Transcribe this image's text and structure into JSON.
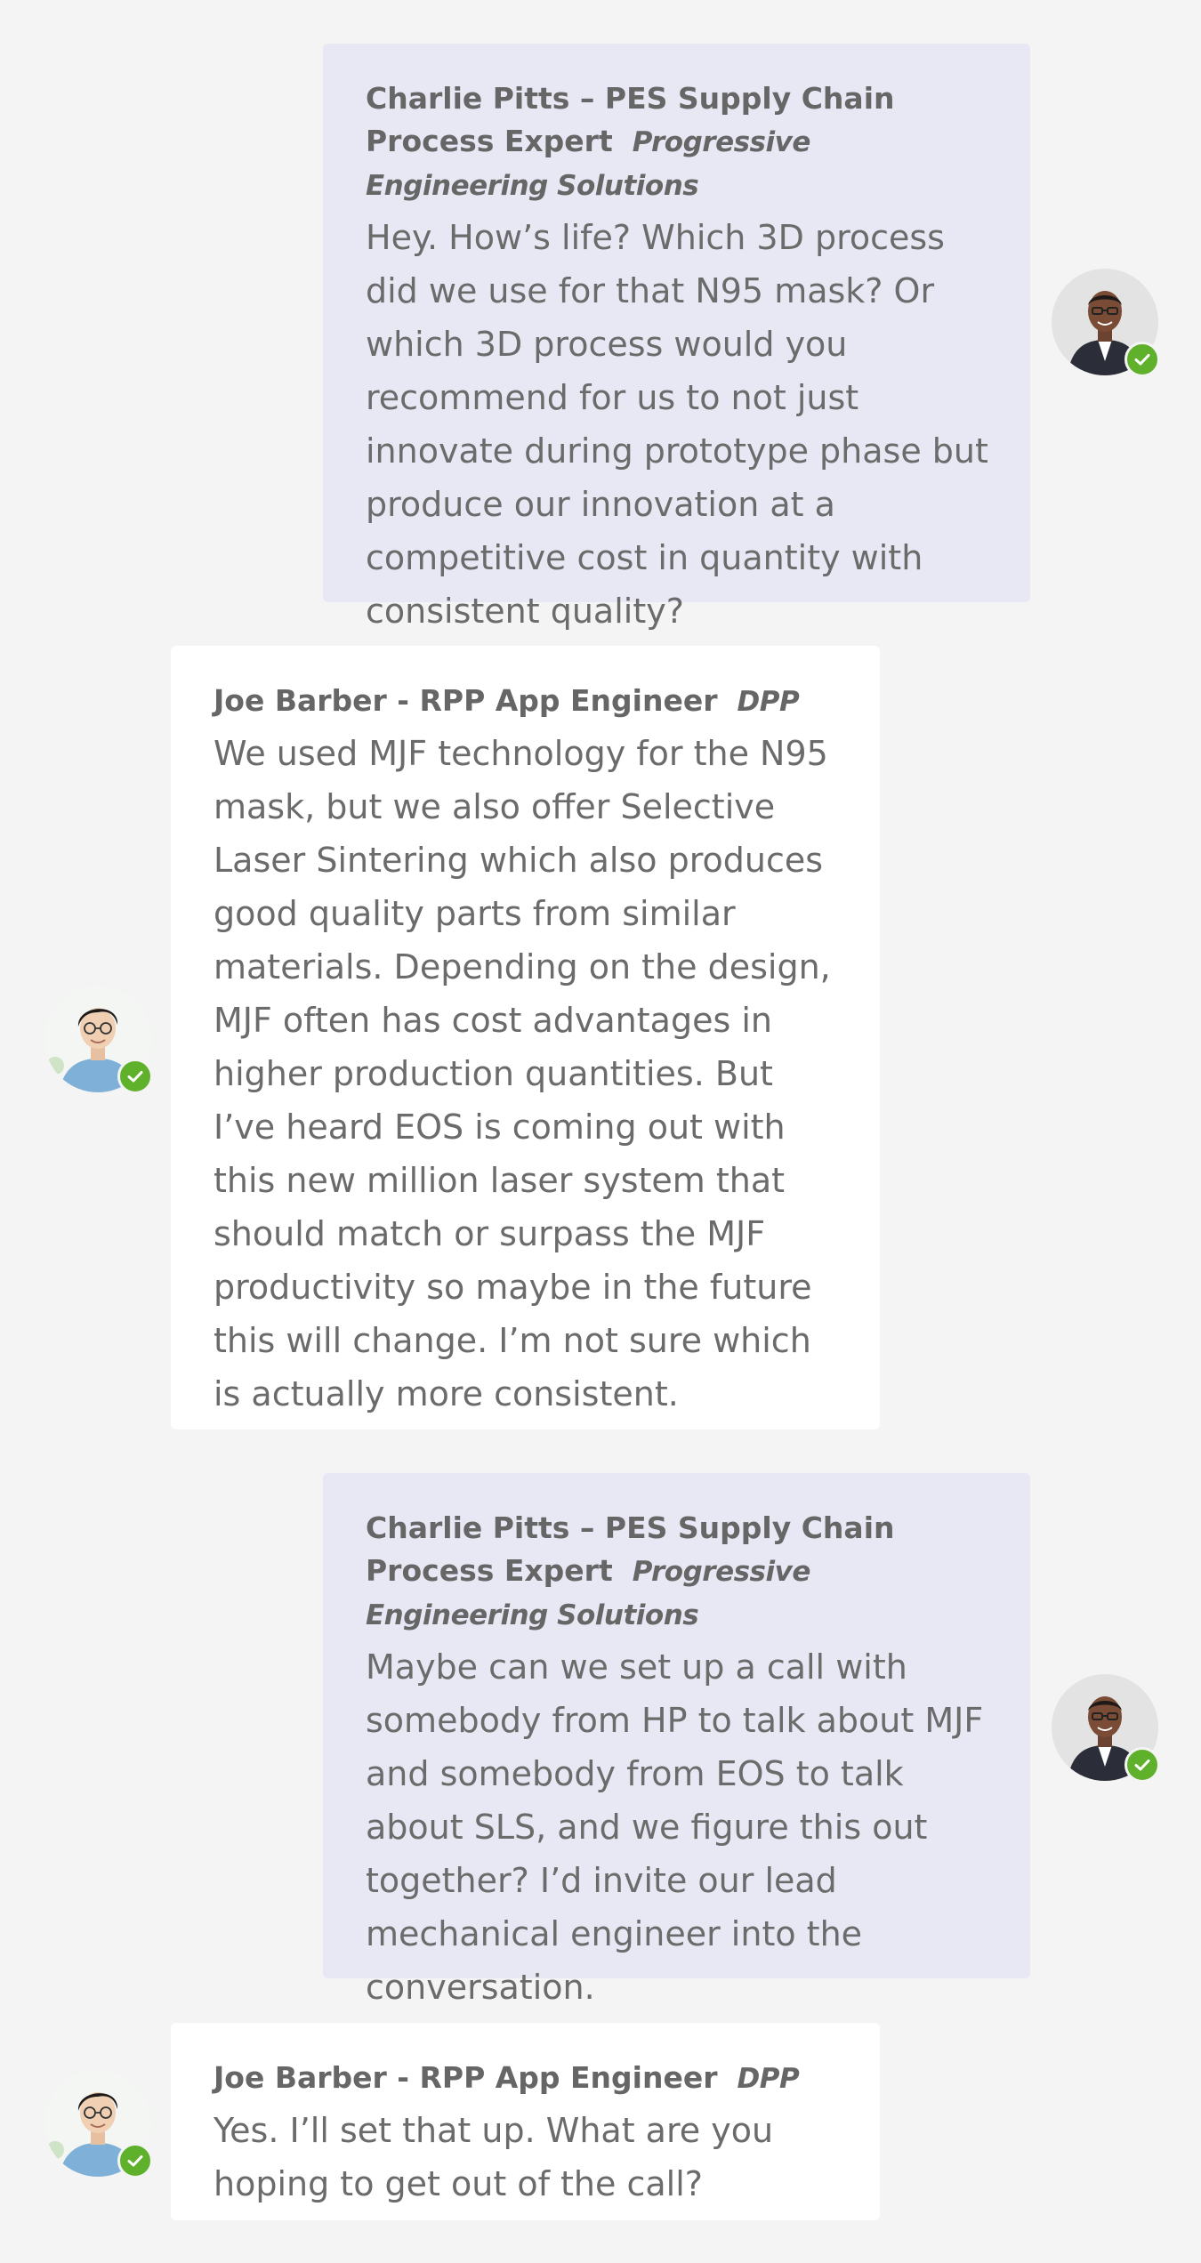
{
  "messages": [
    {
      "sender": "Charlie Pitts – PES Supply Chain Process Expert",
      "org": "Progressive Engineering Solutions",
      "text": "Hey. How’s life? Which 3D process did we use for that N95 mask? Or which 3D process would you recommend for us to not just innovate during prototype phase but produce our innovation at a competitive cost in quantity with consistent quality?",
      "direction": "outgoing",
      "presence": "available"
    },
    {
      "sender": "Joe Barber - RPP App Engineer",
      "org": "DPP",
      "text": "We used MJF technology for the N95 mask, but we also offer Selective Laser Sintering which also produces good quality parts from similar materials. Depending on the design, MJF often has cost advantages in higher production quantities. But I’ve heard EOS is coming out with this new million laser system that should match or surpass the MJF productivity so maybe in the future this will change. I’m not sure which is actually more consistent.",
      "direction": "incoming",
      "presence": "available"
    },
    {
      "sender": "Charlie Pitts – PES Supply Chain Process Expert",
      "org": "Progressive Engineering Solutions",
      "text": "Maybe can we set up a call with somebody from HP to talk about MJF and somebody from EOS to talk about SLS, and we figure this out together? I’d invite our lead mechanical engineer into the conversation.",
      "direction": "outgoing",
      "presence": "available"
    },
    {
      "sender": "Joe Barber - RPP App Engineer",
      "org": "DPP",
      "text": "Yes. I’ll set that up. What are you hoping to get out of the call?",
      "direction": "incoming",
      "presence": "available"
    }
  ],
  "colors": {
    "background": "#f4f4f4",
    "outgoing_bubble": "#e7e8f4",
    "incoming_bubble": "#ffffff",
    "presence_available": "#5fb02a"
  },
  "icons": {
    "presence": "checkmark-icon"
  }
}
